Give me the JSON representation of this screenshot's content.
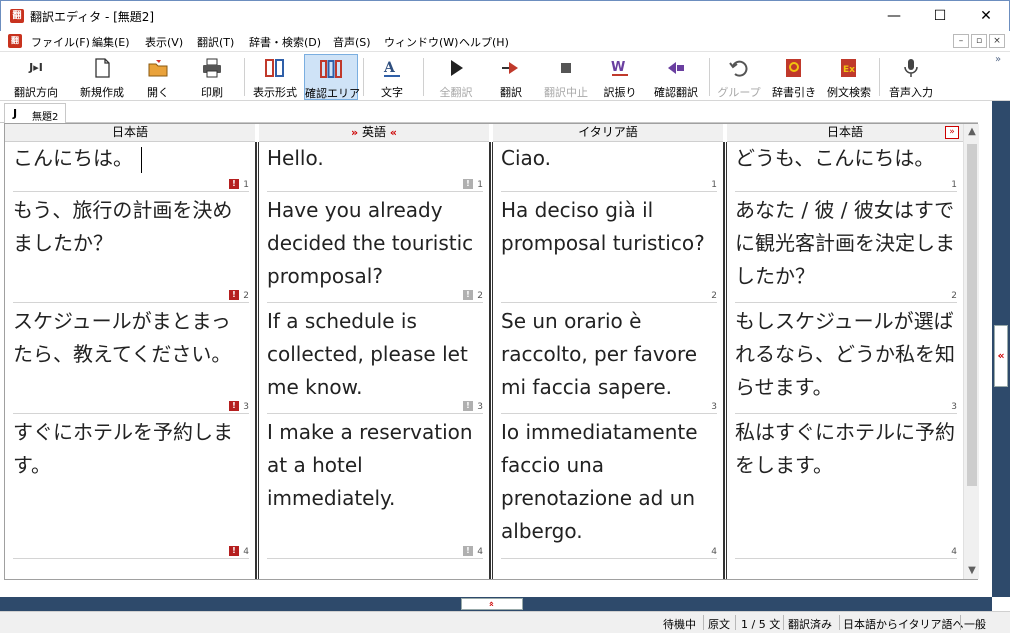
{
  "window": {
    "title": "翻訳エディタ - [無題2]",
    "app_icon": "翻",
    "minimize": "—",
    "maximize": "☐",
    "close": "✕"
  },
  "menu": {
    "items": [
      "ファイル(F)",
      "編集(E)",
      "表示(V)",
      "翻訳(T)",
      "辞書・検索(D)",
      "音声(S)",
      "ウィンドウ(W)",
      "ヘルプ(H)"
    ],
    "mdi_min": "–",
    "mdi_restore": "▫",
    "mdi_close": "×"
  },
  "toolbar": {
    "items": [
      {
        "label": "翻訳方向",
        "icon": "translation-direction-icon"
      },
      {
        "label": "新規作成",
        "icon": "new-document-icon"
      },
      {
        "label": "開く",
        "icon": "open-folder-icon"
      },
      {
        "label": "印刷",
        "icon": "printer-icon"
      },
      {
        "label": "表示形式",
        "icon": "view-format-icon"
      },
      {
        "label": "確認エリア",
        "icon": "confirm-area-icon"
      },
      {
        "label": "文字",
        "icon": "font-icon"
      },
      {
        "label": "全翻訳",
        "icon": "translate-all-icon"
      },
      {
        "label": "翻訳",
        "icon": "translate-icon"
      },
      {
        "label": "翻訳中止",
        "icon": "stop-icon"
      },
      {
        "label": "訳振り",
        "icon": "word-assign-icon"
      },
      {
        "label": "確認翻訳",
        "icon": "confirm-translate-icon"
      },
      {
        "label": "グループ",
        "icon": "group-icon"
      },
      {
        "label": "辞書引き",
        "icon": "dictionary-lookup-icon"
      },
      {
        "label": "例文検索",
        "icon": "example-search-icon"
      },
      {
        "label": "音声入力",
        "icon": "microphone-icon"
      }
    ],
    "direction_glyph": "J▸I",
    "more": "»"
  },
  "document_tab": {
    "lang_code": "J",
    "name": "無題2"
  },
  "columns": [
    {
      "header": "日本語",
      "segments": [
        "こんにちは。",
        "もう、旅行の計画を決めましたか？",
        "スケジュールがまとまったら、教えてください。",
        "すぐにホテルを予約します。"
      ]
    },
    {
      "header": "英語",
      "arrow_left": "»",
      "arrow_right": "«",
      "segments": [
        "Hello.",
        "Have you already decided the touristic promposal?",
        "If a schedule is collected, please let me know.",
        "I make a reservation at a hotel immediately."
      ]
    },
    {
      "header": "イタリア語",
      "segments": [
        "Ciao.",
        "Ha deciso già il promposal turistico?",
        "Se un orario è raccolto, per favore mi faccia sapere.",
        "Io immediatamente faccio una prenotazione ad un albergo."
      ]
    },
    {
      "header": "日本語",
      "arrow_box": "»",
      "segments": [
        "どうも、こんにちは。",
        "あなた / 彼 / 彼女はすでに観光客計画を決定しましたか？",
        "もしスケジュールが選ばれるなら、どうか私を知らせます。",
        "私はすぐにホテルに予約をします。"
      ]
    }
  ],
  "segment_numbers": [
    "1",
    "2",
    "3",
    "4"
  ],
  "flag_glyph": "!",
  "scroll": {
    "up": "▲",
    "down": "▼"
  },
  "splitter": {
    "right_handle": "«",
    "bottom_handle": "»"
  },
  "status": {
    "state": "待機中",
    "mode": "原文",
    "position": "1 / 5 文",
    "translated": "翻訳済み",
    "direction": "日本語からイタリア語へ",
    "field": "一般"
  }
}
